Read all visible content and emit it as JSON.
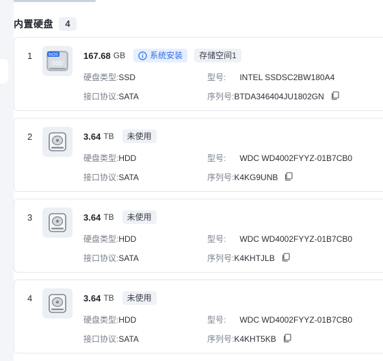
{
  "section": {
    "title": "内置硬盘",
    "count": "4"
  },
  "labels": {
    "disk_type": "硬盘类型:",
    "interface": "接口协议:",
    "model": "型号:",
    "serial": "序列号:"
  },
  "disks": [
    {
      "index": "1",
      "icon": "fnos-ssd-icon",
      "icon_text": "fnOS",
      "icon_sub": "SSD",
      "size": "167.68",
      "unit": "GB",
      "tags": [
        {
          "label": "系统安装",
          "style": "blue",
          "icon": "info-icon"
        },
        {
          "label": "存储空间1",
          "style": "gray"
        }
      ],
      "disk_type": "SSD",
      "interface": "SATA",
      "model": "INTEL SSDSC2BW180A4",
      "serial": "BTDA346404JU1802GN"
    },
    {
      "index": "2",
      "icon": "hard-disk-icon",
      "size": "3.64",
      "unit": "TB",
      "tags": [
        {
          "label": "未使用",
          "style": "gray"
        }
      ],
      "disk_type": "HDD",
      "interface": "SATA",
      "model": "WDC WD4002FYYZ-01B7CB0",
      "serial": "K4KG9UNB"
    },
    {
      "index": "3",
      "icon": "hard-disk-icon",
      "size": "3.64",
      "unit": "TB",
      "tags": [
        {
          "label": "未使用",
          "style": "gray"
        }
      ],
      "disk_type": "HDD",
      "interface": "SATA",
      "model": "WDC WD4002FYYZ-01B7CB0",
      "serial": "K4KHTJLB"
    },
    {
      "index": "4",
      "icon": "hard-disk-icon",
      "size": "3.64",
      "unit": "TB",
      "tags": [
        {
          "label": "未使用",
          "style": "gray"
        }
      ],
      "disk_type": "HDD",
      "interface": "SATA",
      "model": "WDC WD4002FYYZ-01B7CB0",
      "serial": "K4KHT5KB"
    }
  ],
  "colors": {
    "accent": "#2f6fe4",
    "accent_bg": "#e5efff",
    "tag_gray_bg": "#eef1f5",
    "label_gray": "#7a818b",
    "page_bg": "#f3f5f8"
  }
}
